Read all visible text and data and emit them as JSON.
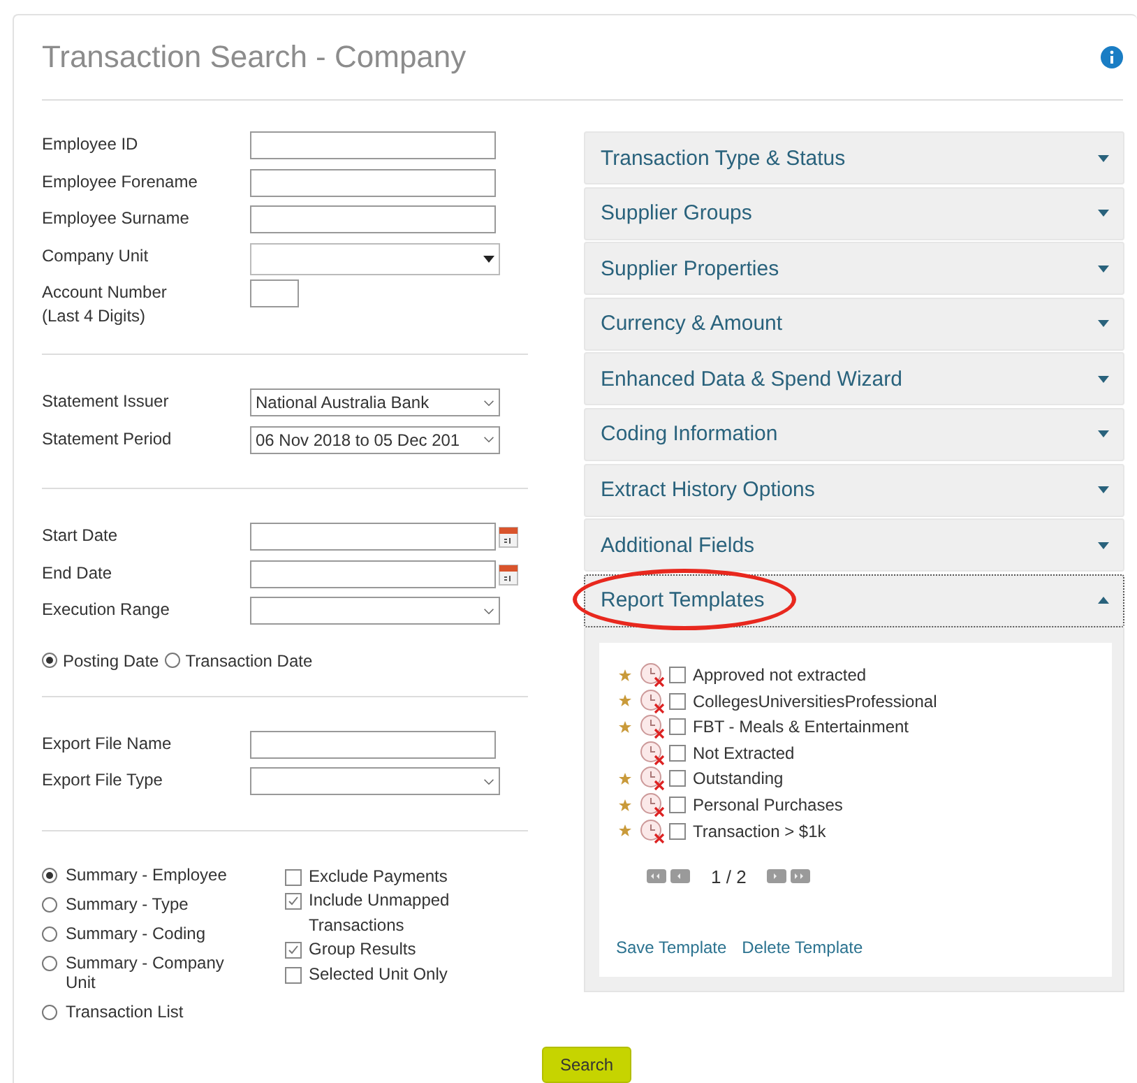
{
  "title": "Transaction Search - Company",
  "employee_fields": [
    {
      "label": "Employee ID",
      "kind": "text"
    },
    {
      "label": "Employee Forename",
      "kind": "text"
    },
    {
      "label": "Employee Surname",
      "kind": "text"
    },
    {
      "label": "Company Unit",
      "kind": "combo"
    },
    {
      "label": "Account Number (Last 4 Digits)",
      "kind": "short"
    }
  ],
  "statement_fields": [
    {
      "label": "Statement Issuer",
      "kind": "select",
      "value": "National Australia Bank"
    },
    {
      "label": "Statement Period",
      "kind": "select",
      "value": "06 Nov 2018 to 05 Dec 201"
    }
  ],
  "date_fields": [
    {
      "label": "Start Date",
      "kind": "date"
    },
    {
      "label": "End Date",
      "kind": "date"
    },
    {
      "label": "Execution Range",
      "kind": "select"
    }
  ],
  "date_basis": [
    {
      "label": "Posting Date",
      "selected": true
    },
    {
      "label": "Transaction Date",
      "selected": false
    }
  ],
  "export_fields": [
    {
      "label": "Export File Name",
      "kind": "text"
    },
    {
      "label": "Export File Type",
      "kind": "select"
    }
  ],
  "report_types": [
    {
      "label": "Summary - Employee",
      "selected": true
    },
    {
      "label": "Summary - Type",
      "selected": false
    },
    {
      "label": "Summary - Coding",
      "selected": false
    },
    {
      "label": "Summary - Company Unit",
      "selected": false
    },
    {
      "label": "Transaction List",
      "selected": false
    }
  ],
  "options": [
    {
      "label": "Exclude Payments",
      "checked": false
    },
    {
      "label": "Include Unmapped Transactions",
      "checked": true
    },
    {
      "label": "Group Results",
      "checked": true
    },
    {
      "label": "Selected Unit Only",
      "checked": false
    }
  ],
  "sections": [
    {
      "label": "Transaction Type & Status",
      "expanded": false,
      "highlighted": false
    },
    {
      "label": "Supplier Groups",
      "expanded": false,
      "highlighted": false
    },
    {
      "label": "Supplier Properties",
      "expanded": false,
      "highlighted": false
    },
    {
      "label": "Currency & Amount",
      "expanded": false,
      "highlighted": false
    },
    {
      "label": "Enhanced Data & Spend Wizard",
      "expanded": false,
      "highlighted": false
    },
    {
      "label": "Coding Information",
      "expanded": false,
      "highlighted": false
    },
    {
      "label": "Extract History Options",
      "expanded": false,
      "highlighted": false
    },
    {
      "label": "Additional Fields",
      "expanded": false,
      "highlighted": false
    },
    {
      "label": "Report Templates",
      "expanded": true,
      "highlighted": true
    }
  ],
  "templates": [
    {
      "label": "Approved not extracted",
      "starred": true,
      "checked": false
    },
    {
      "label": "CollegesUniversitiesProfessional",
      "starred": true,
      "checked": false
    },
    {
      "label": "FBT - Meals & Entertainment",
      "starred": true,
      "checked": false
    },
    {
      "label": "Not Extracted",
      "starred": false,
      "checked": false
    },
    {
      "label": "Outstanding",
      "starred": true,
      "checked": false
    },
    {
      "label": "Personal Purchases",
      "starred": true,
      "checked": false
    },
    {
      "label": "Transaction > $1k",
      "starred": true,
      "checked": false
    }
  ],
  "pager": "1 / 2",
  "template_links": [
    "Save Template",
    "Delete Template"
  ],
  "search_button": "Search"
}
